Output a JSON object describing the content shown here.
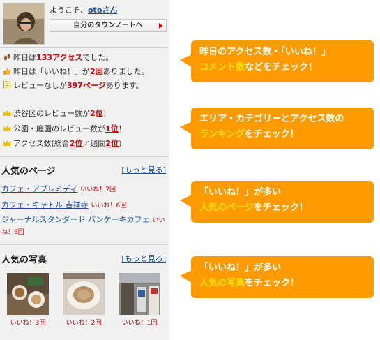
{
  "user": {
    "greeting_prefix": "ようこそ、",
    "name": "otoさん",
    "mynote_label": "自分のタウンノートへ"
  },
  "stats": {
    "line1_a": "昨日は",
    "line1_value": "133アクセス",
    "line1_b": "でした。",
    "line2_a": "昨日は「いいね！」が",
    "line2_value": "2回",
    "line2_b": "ありました。",
    "line3_a": "レビューなしが",
    "line3_value": "397ページ",
    "line3_b": "あります。"
  },
  "ranking": {
    "line1_a": "渋谷区のレビュー数が",
    "line1_value": "2位",
    "line1_b": "！",
    "line2_a": "公園・庭園のレビュー数が",
    "line2_value": "1位",
    "line2_b": "！",
    "line3_a": "アクセス数(総合",
    "line3_value1": "2位",
    "line3_sep": "／週間",
    "line3_value2": "2位",
    "line3_b": ")"
  },
  "popular_pages": {
    "title": "人気のページ",
    "more_label": "[もっと見る]",
    "items": [
      {
        "name": "カフェ・アプレミディ",
        "likes": "いいね！7回"
      },
      {
        "name": "カフェ・キャトル 吉祥寺",
        "likes": "いいね！6回"
      },
      {
        "name": "ジャーナルスタンダード パンケーキカフェ",
        "likes": "いいね！6回"
      }
    ]
  },
  "popular_photos": {
    "title": "人気の写真",
    "more_label": "[もっと見る]",
    "items": [
      {
        "likes": "いいね！3回"
      },
      {
        "likes": "いいね！2回"
      },
      {
        "likes": "いいね！1回"
      }
    ]
  },
  "callouts": {
    "c1_line1": "昨日のアクセス数・「いいね！」",
    "c1_line2a": "コメント数",
    "c1_line2b": "などをチェック！",
    "c2_line1": "エリア・カテゴリーとアクセス数の",
    "c2_line2a": "ランキング",
    "c2_line2b": "をチェック！",
    "c3_line1": "「いいね！」が多い",
    "c3_line2a": "人気のページ",
    "c3_line2b": "をチェック！",
    "c4_line1": "「いいね！」が多い",
    "c4_line2a": "人気の写真",
    "c4_line2b": "をチェック！"
  },
  "colors": {
    "accent_orange": "#ff9b00",
    "highlight_yellow": "#ffe100",
    "value_red": "#cc0000",
    "link_blue": "#1a4fa0"
  }
}
